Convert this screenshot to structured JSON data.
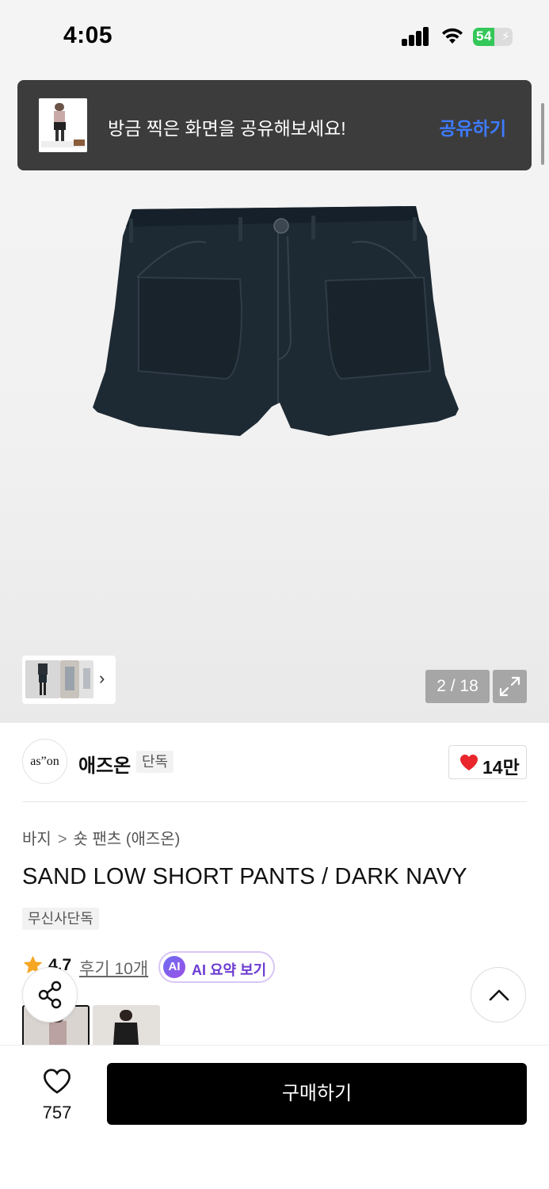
{
  "status_bar": {
    "time": "4:05",
    "battery": "54",
    "battery_level": 0.54,
    "icons": [
      "signal-icon",
      "wifi-icon",
      "battery-icon"
    ]
  },
  "share_toast": {
    "message": "방금 찍은 화면을 공유해보세요!",
    "action": "공유하기",
    "action_color": "#3d7bff"
  },
  "gallery": {
    "counter": "2 / 18",
    "icons": [
      "chevron-right-icon",
      "expand-icon"
    ]
  },
  "brand": {
    "logo_text": "as”on",
    "name": "애즈온",
    "tag": "단독",
    "like_count": "14만",
    "heart_color": "#e8262c"
  },
  "breadcrumb": {
    "category": "바지",
    "separator": ">",
    "subcategory": "숏 팬츠 (애즈온)"
  },
  "product": {
    "title": "SAND LOW SHORT PANTS / DARK NAVY",
    "badge": "무신사단독"
  },
  "rating": {
    "score": "4.7",
    "review_link": "후기 10개",
    "star_color": "#f5a623"
  },
  "ai_summary": {
    "icon_text": "AI",
    "label": "AI 요약 보기"
  },
  "bottom_bar": {
    "wish_count": "757",
    "buy_label": "구매하기"
  }
}
